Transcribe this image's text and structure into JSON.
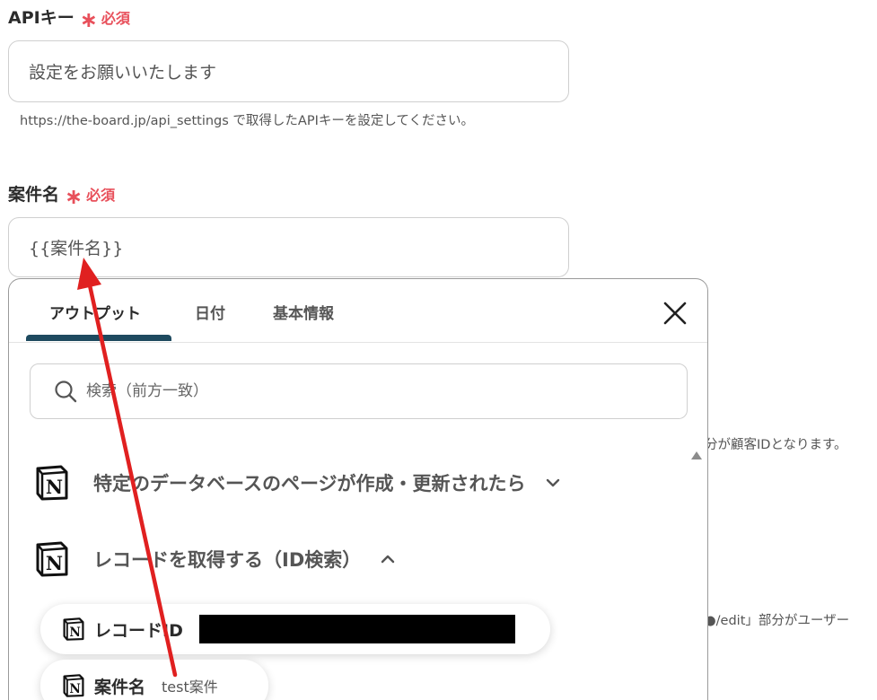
{
  "api_key_field": {
    "label": "APIキー",
    "required_mark": "∗",
    "required_text": "必須",
    "value": "設定をお願いいたします",
    "help": "https://the-board.jp/api_settings で取得したAPIキーを設定してください。"
  },
  "project_name_field": {
    "label": "案件名",
    "required_mark": "∗",
    "required_text": "必須",
    "value": "{{案件名}}"
  },
  "background_help": {
    "line1": "分が顧客IDとなります。",
    "line2": "●/edit」部分がユーザー"
  },
  "panel": {
    "tabs": [
      {
        "label": "アウトプット",
        "active": true
      },
      {
        "label": "日付",
        "active": false
      },
      {
        "label": "基本情報",
        "active": false
      }
    ],
    "search": {
      "placeholder": "検索（前方一致）"
    },
    "sections": [
      {
        "icon": "notion-icon",
        "title": "特定のデータベースのページが作成・更新されたら",
        "expanded": false
      },
      {
        "icon": "notion-icon",
        "title": "レコードを取得する（ID検索）",
        "expanded": true
      }
    ],
    "items": [
      {
        "icon": "notion-icon",
        "label": "レコードID",
        "value_redacted": true
      },
      {
        "icon": "notion-icon",
        "label": "案件名",
        "value": "test案件"
      }
    ]
  },
  "annotation": {
    "color": "#e02020"
  }
}
